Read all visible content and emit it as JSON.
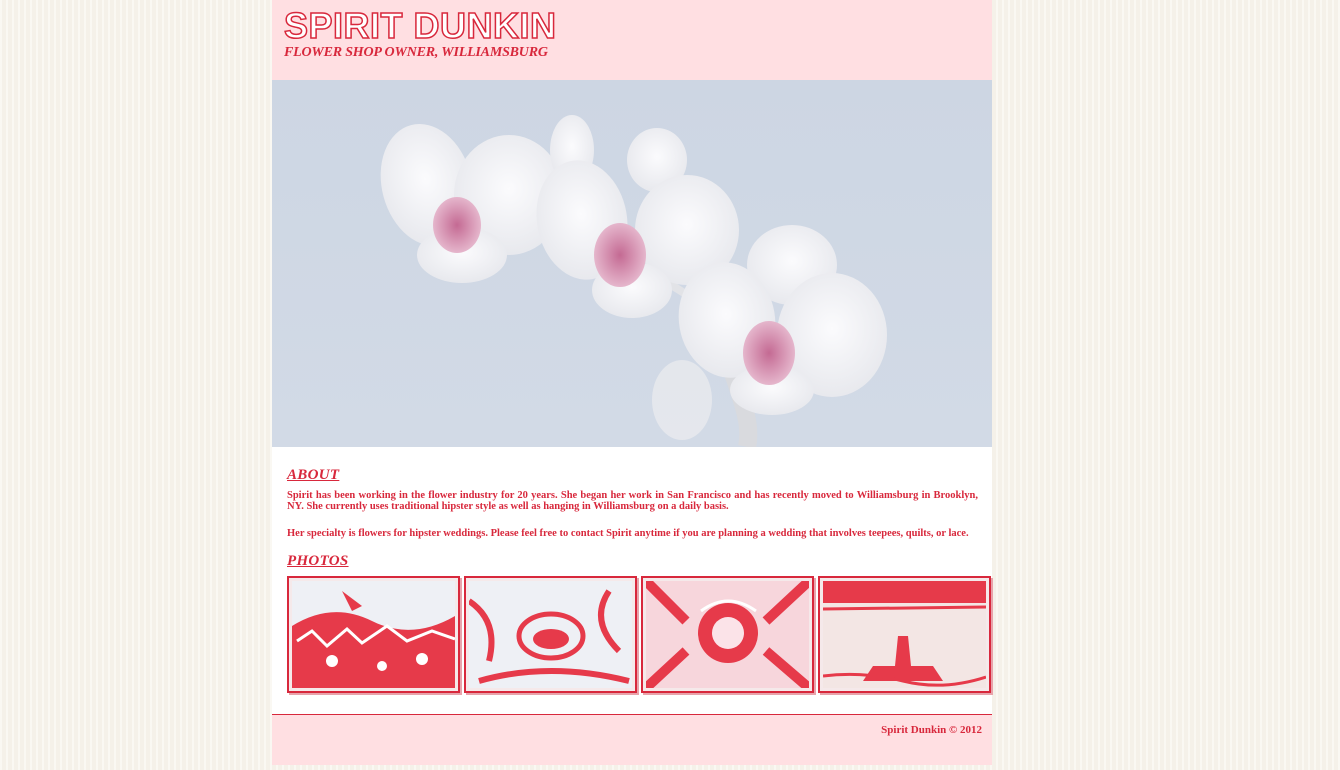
{
  "header": {
    "title": "SPIRIT DUNKIN",
    "subtitle": "FLOWER SHOP OWNER, WILLIAMSBURG"
  },
  "hero": {
    "image": "white-orchid-photo"
  },
  "about": {
    "heading": "ABOUT",
    "paragraphs": [
      "Spirit has been working in the flower industry for 20 years. She began her work in San Francisco and has recently moved to Williamsburg in Brooklyn, NY. She currently uses traditional hipster style as well as hanging in Williamsburg on a daily basis.",
      "Her specialty is flowers for hipster weddings. Please feel free to contact Spirit anytime if you are planning a wedding that involves teepees, quilts, or lace."
    ]
  },
  "photos": {
    "heading": "PHOTOS",
    "items": [
      "flower-field-thumbnail",
      "flower-closeup-thumbnail",
      "pink-bloom-thumbnail",
      "landscape-thumbnail"
    ]
  },
  "footer": {
    "copyright": "Spirit Dunkin © 2012"
  },
  "colors": {
    "accent": "#d8283c",
    "header_bg": "#ffdfe2",
    "page_bg": "#f8f4ec"
  }
}
